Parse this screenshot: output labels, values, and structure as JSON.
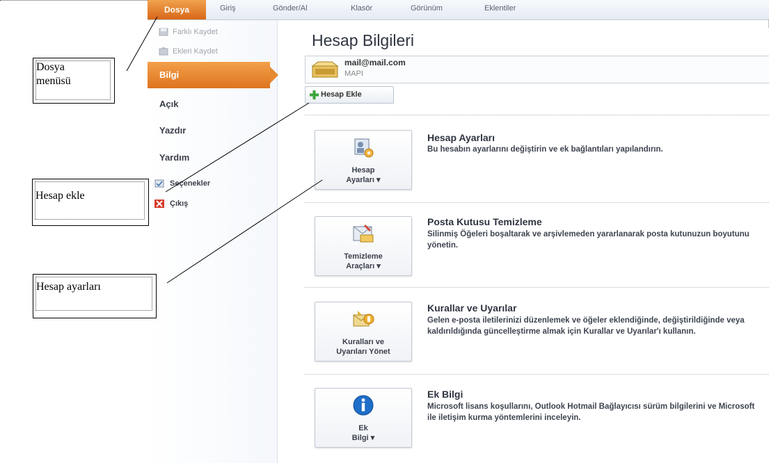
{
  "ribbon": {
    "tabs": [
      "Dosya",
      "Giriş",
      "Gönder/Al",
      "Klasör",
      "Görünüm",
      "Eklentiler"
    ]
  },
  "nav": {
    "save_as": "Farklı Kaydet",
    "save_attachments": "Ekleri Kaydet",
    "info": "Bilgi",
    "open": "Açık",
    "print": "Yazdır",
    "help": "Yardım",
    "options": "Seçenekler",
    "exit": "Çıkış"
  },
  "account": {
    "title": "Hesap Bilgileri",
    "email": "mail@mail.com",
    "type": "MAPI",
    "add_label": "Hesap Ekle"
  },
  "sections": [
    {
      "button": "Hesap\nAyarları ▾",
      "title": "Hesap Ayarları",
      "desc": "Bu hesabın ayarlarını değiştirin ve ek bağlantıları yapılandırın."
    },
    {
      "button": "Temizleme\nAraçları ▾",
      "title": "Posta Kutusu Temizleme",
      "desc": "Silinmiş Öğeleri boşaltarak ve arşivlemeden yararlanarak posta kutunuzun boyutunu yönetin."
    },
    {
      "button": "Kuralları ve\nUyarıları Yönet",
      "title": "Kurallar ve Uyarılar",
      "desc": "Gelen e-posta iletilerinizi düzenlemek ve öğeler eklendiğinde, değiştirildiğinde veya kaldırıldığında güncelleştirme almak için Kurallar ve Uyarılar'ı kullanın."
    },
    {
      "button": "Ek\nBilgi ▾",
      "title": "Ek Bilgi",
      "desc": "Microsoft lisans koşullarını, Outlook Hotmail Bağlayıcısı sürüm bilgilerini ve Microsoft ile iletişim kurma yöntemlerini inceleyin."
    }
  ],
  "callouts": {
    "file_menu": "Dosya\nmenüsü",
    "add_account": "Hesap ekle",
    "account_settings": "Hesap ayarları"
  },
  "colors": {
    "accent_orange": "#e07a25",
    "add_icon_green": "#3aa33a",
    "info_icon_blue": "#1e6fc9"
  }
}
